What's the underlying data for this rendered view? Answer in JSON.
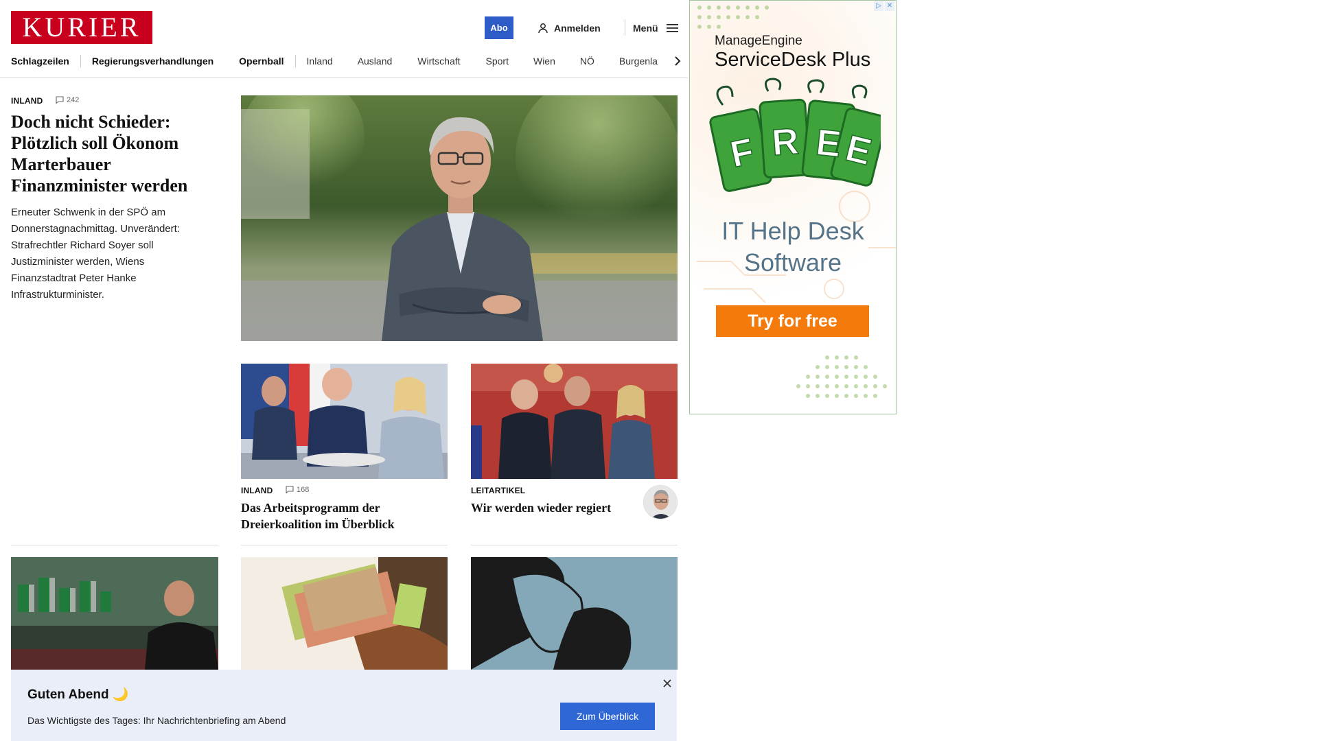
{
  "brand": {
    "logo": "KURIER"
  },
  "header": {
    "abo": "Abo",
    "login": "Anmelden",
    "menu": "Menü"
  },
  "nav": [
    "Schlagzeilen",
    "Regierungsverhandlungen",
    "Opernball",
    "Inland",
    "Ausland",
    "Wirtschaft",
    "Sport",
    "Wien",
    "NÖ",
    "Burgenla"
  ],
  "lead": {
    "kicker": "INLAND",
    "comments": "242",
    "title": "Doch nicht Schieder: Plötzlich soll Ökonom Marterbauer Finanzminister werden",
    "teaser": "Erneuter Schwenk in der SPÖ am Donnerstagnachmittag. Unverändert: Strafrechtler Richard Soyer soll Justizminister werden, Wiens Finanzstadtrat Peter Hanke Infrastrukturminister."
  },
  "cards": [
    {
      "kicker": "INLAND",
      "comments": "168",
      "title": "Das Arbeitsprogramm der Dreierkoalition im Überblick"
    },
    {
      "kicker": "LEITARTIKEL",
      "title": "Wir werden wieder regiert"
    }
  ],
  "ad": {
    "brand": "ManageEngine",
    "product": "ServiceDesk Plus",
    "tag_letters": [
      "F",
      "R",
      "E",
      "E"
    ],
    "headline_line1": "IT Help Desk",
    "headline_line2": "Software",
    "cta": "Try for free",
    "badge_info": "▷",
    "badge_close": "✕"
  },
  "briefing": {
    "title": "Guten Abend 🌙",
    "subtitle": "Das Wichtigste des Tages: Ihr Nachrichtenbriefing am Abend",
    "button": "Zum Überblick"
  },
  "colors": {
    "brand_red": "#c8001d",
    "abo_blue": "#2d5cc9",
    "ad_orange": "#f57a0c",
    "briefing_bg": "#e9eef8"
  }
}
